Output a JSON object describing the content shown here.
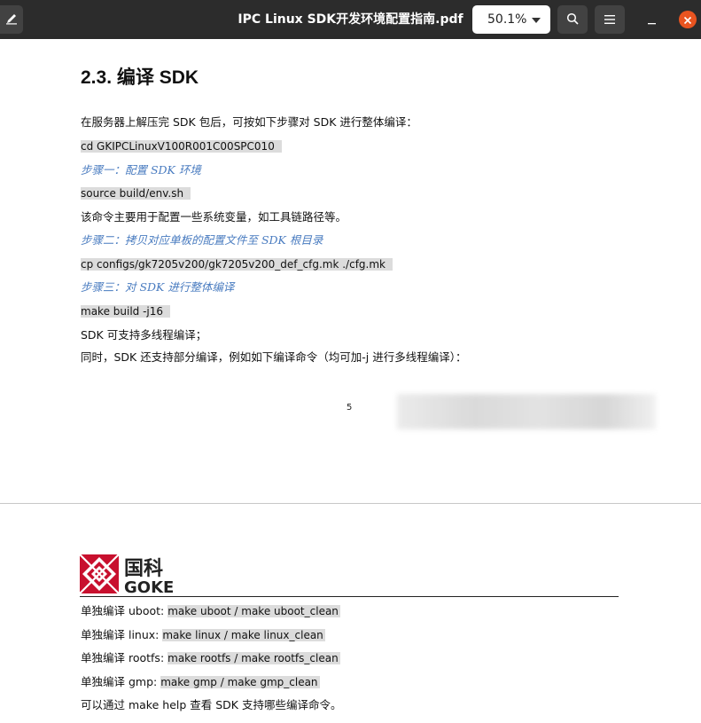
{
  "header": {
    "title": "IPC Linux SDK开发环境配置指南.pdf",
    "zoom": "50.1%",
    "icons": [
      "edit-icon",
      "search-icon",
      "hamburger-menu-icon",
      "minimize-icon",
      "close-icon"
    ]
  },
  "page1": {
    "heading": "2.3. 编译 SDK",
    "intro": "在服务器上解压完 SDK 包后，可按如下步骤对 SDK 进行整体编译：",
    "cmd1": "cd GKIPCLinuxV100R001C00SPC010",
    "step1": "步骤一：配置 SDK 环境",
    "cmd2": "source build/env.sh",
    "desc2": "该命令主要用于配置一些系统变量，如工具链路径等。",
    "step2": "步骤二：拷贝对应单板的配置文件至 SDK 根目录",
    "cmd3": "cp configs/gk7205v200/gk7205v200_def_cfg.mk ./cfg.mk",
    "step3": "步骤三：对 SDK 进行整体编译",
    "cmd4": "make build -j16",
    "desc4a": "SDK 可支持多线程编译；",
    "desc4b": "同时，SDK 还支持部分编译，例如如下编译命令（均可加-j 进行多线程编译）：",
    "page_number": "5"
  },
  "page2": {
    "logo_cn": "国科",
    "logo_en": "GOKE",
    "items": [
      {
        "label": "单独编译 uboot: ",
        "cmd": "make uboot / make uboot_clean"
      },
      {
        "label": "单独编译 linux: ",
        "cmd": "make linux / make linux_clean"
      },
      {
        "label": "单独编译 rootfs: ",
        "cmd": "make rootfs / make rootfs_clean"
      },
      {
        "label": "单独编译 gmp: ",
        "cmd": "make gmp / make gmp_clean"
      }
    ],
    "footer": "可以通过 make help 查看 SDK 支持哪些编译命令。"
  },
  "colors": {
    "accent_close": "#e95420",
    "step_text": "#4a7cc0",
    "code_bg": "#dcdcdc"
  }
}
